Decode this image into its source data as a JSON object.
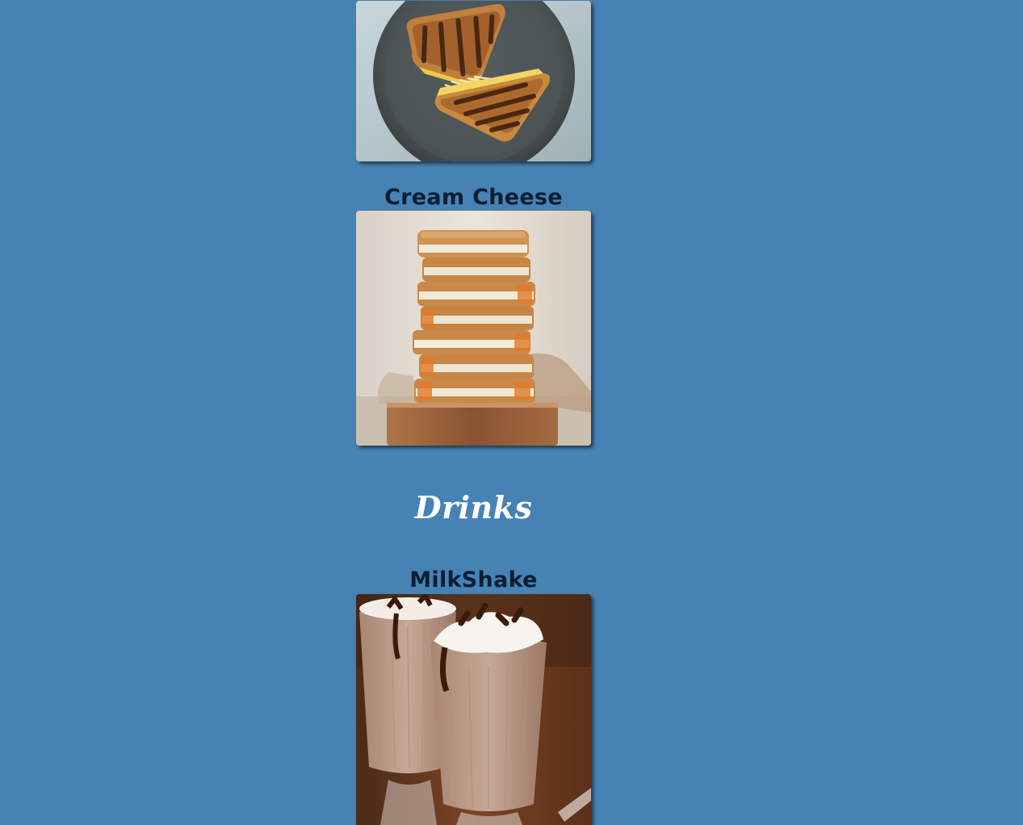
{
  "menu": {
    "items": [
      {
        "title": "",
        "image_alt": "grilled-cheese-sandwich-photo"
      },
      {
        "title": "Cream Cheese",
        "image_alt": "stacked-cream-cheese-sandwich-photo"
      }
    ],
    "drinks_section": {
      "heading": "Drinks",
      "items": [
        {
          "title": "MilkShake",
          "image_alt": "chocolate-milkshake-photo"
        }
      ]
    }
  },
  "colors": {
    "background": "#4682b4",
    "item_title": "#0a1e33",
    "section_title": "#ffffff"
  }
}
